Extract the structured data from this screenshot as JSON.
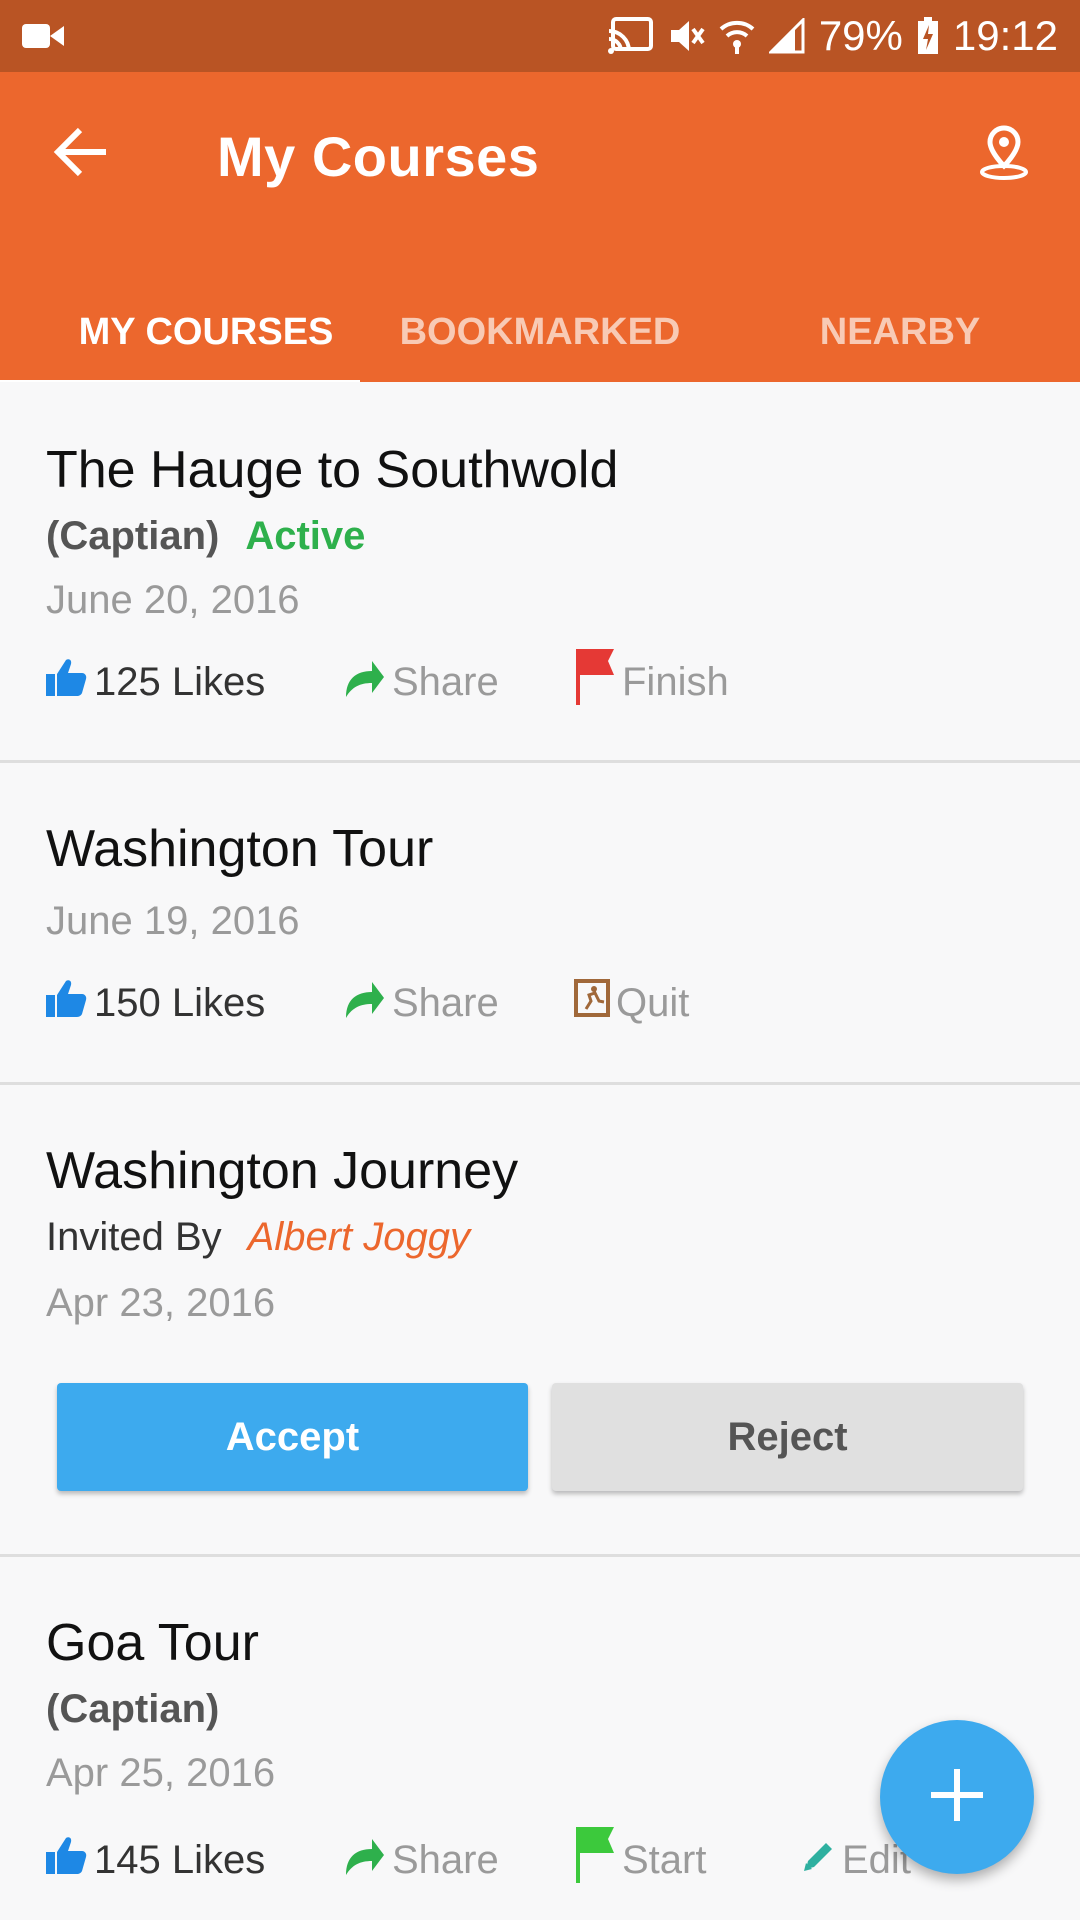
{
  "status_bar": {
    "battery": "79%",
    "time": "19:12"
  },
  "app_bar": {
    "title": "My Courses"
  },
  "tabs": [
    {
      "label": "MY COURSES",
      "active": true
    },
    {
      "label": "BOOKMARKED",
      "active": false
    },
    {
      "label": "NEARBY",
      "active": false
    }
  ],
  "courses": [
    {
      "title": "The Hauge to Southwold",
      "role": "(Captian)",
      "status": "Active",
      "date": "June 20, 2016",
      "likes": "125 Likes",
      "share": "Share",
      "action": "Finish"
    },
    {
      "title": "Washington Tour",
      "date": "June 19, 2016",
      "likes": "150 Likes",
      "share": "Share",
      "action": "Quit"
    },
    {
      "title": "Washington Journey",
      "invited_label": "Invited By",
      "inviter": "Albert Joggy",
      "date": "Apr 23, 2016",
      "accept": "Accept",
      "reject": "Reject"
    },
    {
      "title": "Goa Tour",
      "role": "(Captian)",
      "date": "Apr 25, 2016",
      "likes": "145 Likes",
      "share": "Share",
      "action": "Start",
      "edit": "Edit"
    }
  ],
  "colors": {
    "status_bar": "#b95424",
    "app_bar": "#ec672d",
    "accent_blue": "#3daaee",
    "active_green": "#2eb04c",
    "share_green": "#2eb04c",
    "finish_red": "#e53935",
    "start_green": "#3cc93c"
  },
  "icons": [
    "video-icon",
    "cast-icon",
    "mute-icon",
    "wifi-icon",
    "signal-icon",
    "battery-icon",
    "back-arrow-icon",
    "location-pin-icon",
    "thumbs-up-icon",
    "share-icon",
    "red-flag-icon",
    "exit-icon",
    "green-flag-icon",
    "pencil-icon",
    "plus-icon"
  ]
}
